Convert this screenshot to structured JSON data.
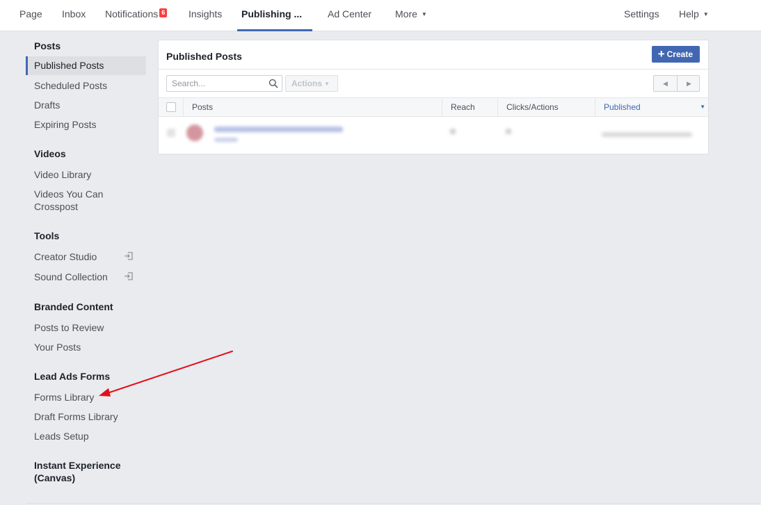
{
  "topnav": {
    "items": [
      {
        "label": "Page"
      },
      {
        "label": "Inbox"
      },
      {
        "label": "Notifications",
        "badge": "6"
      },
      {
        "label": "Insights"
      },
      {
        "label": "Publishing ..."
      },
      {
        "label": "Ad Center"
      },
      {
        "label": "More"
      }
    ],
    "right": [
      {
        "label": "Settings"
      },
      {
        "label": "Help"
      }
    ]
  },
  "sidebar": {
    "posts": {
      "title": "Posts",
      "items": [
        {
          "label": "Published Posts"
        },
        {
          "label": "Scheduled Posts"
        },
        {
          "label": "Drafts"
        },
        {
          "label": "Expiring Posts"
        }
      ]
    },
    "videos": {
      "title": "Videos",
      "items": [
        {
          "label": "Video Library"
        },
        {
          "label": "Videos You Can"
        },
        {
          "label": "Crosspost"
        }
      ]
    },
    "tools": {
      "title": "Tools",
      "items": [
        {
          "label": "Creator Studio",
          "icon": "external-link-icon"
        },
        {
          "label": "Sound Collection",
          "icon": "external-link-icon"
        }
      ]
    },
    "branded": {
      "title": "Branded Content",
      "items": [
        {
          "label": "Posts to Review"
        },
        {
          "label": "Your Posts"
        }
      ]
    },
    "leadads": {
      "title": "Lead Ads Forms",
      "items": [
        {
          "label": "Forms Library"
        },
        {
          "label": "Draft Forms Library"
        },
        {
          "label": "Leads Setup"
        }
      ]
    },
    "instant": {
      "title_line1": "Instant Experience",
      "title_line2": "(Canvas)"
    }
  },
  "main": {
    "title": "Published Posts",
    "create_label": "Create",
    "search_placeholder": "Search...",
    "actions_label": "Actions",
    "columns": [
      "Posts",
      "Reach",
      "Clicks/Actions",
      "Published"
    ],
    "sorted_column": "Published"
  },
  "colors": {
    "accent": "#4267b2",
    "badge": "#fa3e3e",
    "annotation_arrow": "#e0101a"
  }
}
